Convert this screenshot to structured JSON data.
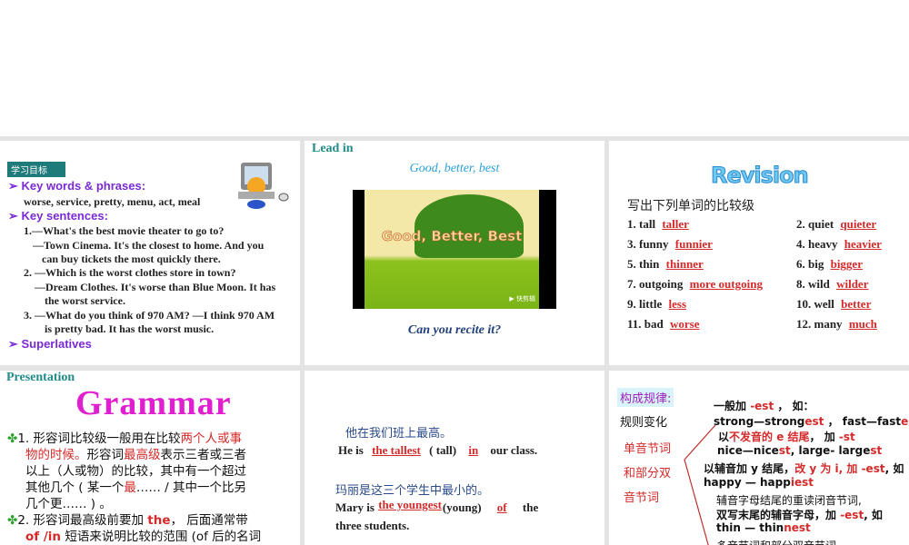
{
  "slide1": {
    "tag": "学习目标",
    "kw_title": "Key words & phrases:",
    "kw": "worse, service, pretty, menu, act, meal",
    "ks_title": "Key sentences:",
    "lines": [
      "1.—What's the best movie theater to go to?",
      "—Town Cinema. It's the closest to home. And you",
      "can buy tickets the most quickly there.",
      "2. —Which is the worst clothes store in town?",
      "—Dream Clothes. It's worse than Blue Moon. It has",
      "the worst service.",
      "3. —What do you think of 970 AM?  —I think 970 AM",
      "is pretty bad. It has the worst music."
    ],
    "sup": "Superlatives"
  },
  "slide2": {
    "heading": "Lead in",
    "subtitle": "Good, better, best",
    "video_title": "Good, Better, Best",
    "video_logo": "▶ 快剪辑",
    "question": "Can you recite it?"
  },
  "slide3": {
    "title": "Revision",
    "instruction": "写出下列单词的比较级",
    "items": [
      {
        "q": "1. tall",
        "a": "taller"
      },
      {
        "q": "2. quiet",
        "a": "quieter"
      },
      {
        "q": "3. funny",
        "a": "funnier"
      },
      {
        "q": "4. heavy",
        "a": "heavier"
      },
      {
        "q": "5. thin",
        "a": "thinner"
      },
      {
        "q": "6. big",
        "a": "bigger"
      },
      {
        "q": "7. outgoing",
        "a": "more outgoing"
      },
      {
        "q": "8. wild",
        "a": "wilder"
      },
      {
        "q": "9. little",
        "a": "less"
      },
      {
        "q": "10. well",
        "a": "better"
      },
      {
        "q": "11. bad",
        "a": "worse"
      },
      {
        "q": "12. many",
        "a": "much"
      }
    ]
  },
  "slide4": {
    "heading": "Presentation",
    "title": "Grammar",
    "p1": [
      "1. 形容词比较级一般用在比较",
      "两个人或事",
      "物的时候。",
      "形容词",
      "最高级",
      "表示三者或三者",
      "以上（人或物）的比较，其中有一个超过",
      "其他几个 ( 某一个",
      "最",
      "…… / 其中一个比另",
      "几个更…… ) 。"
    ],
    "p2": [
      "2. 形容词最高级前要加 ",
      "the",
      "， 后面通常带",
      "of /in",
      " 短语来说明比较的范围 (of  后的名词"
    ]
  },
  "slide5": {
    "cn1": "他在我们班上最高。",
    "s1a": "He is ",
    "a1": "the tallest",
    "s1b": " ( tall) ",
    "a2": "in",
    "s1c": " our class.",
    "cn2": "玛丽是这三个学生中最小的。",
    "s2a": "Mary is ",
    "a3": "the youngest",
    "s2b": "(young) ",
    "a4": "of",
    "s2c": " the",
    "s2d": "three students."
  },
  "slide6": {
    "label": "构成规律:",
    "sub": "规则变化",
    "cat": [
      "单音节词",
      "和部分双",
      "音节词"
    ],
    "r1": [
      "一般加 ",
      "-est",
      " ，  如："
    ],
    "r2": [
      "strong—strong",
      "est",
      " ，  fast—fast",
      "est"
    ],
    "r3": [
      "以",
      "不发音的 e 结尾",
      "，   加 ",
      "-st"
    ],
    "r4": [
      "nice—nice",
      "st",
      ",  large- large",
      "st"
    ],
    "r5": [
      "以辅音加 y 结尾，",
      "改 y 为 i, 加 -est",
      ", 如"
    ],
    "r6": [
      "happy — happ",
      "iest"
    ],
    "r7": "辅音字母结尾的重读闭音节词,",
    "r8": [
      "双写末尾的辅音字母，加 ",
      "-est",
      ", 如"
    ],
    "r9": [
      "thin — thin",
      "nest"
    ],
    "r10": "多音节词和部分双音节词"
  }
}
